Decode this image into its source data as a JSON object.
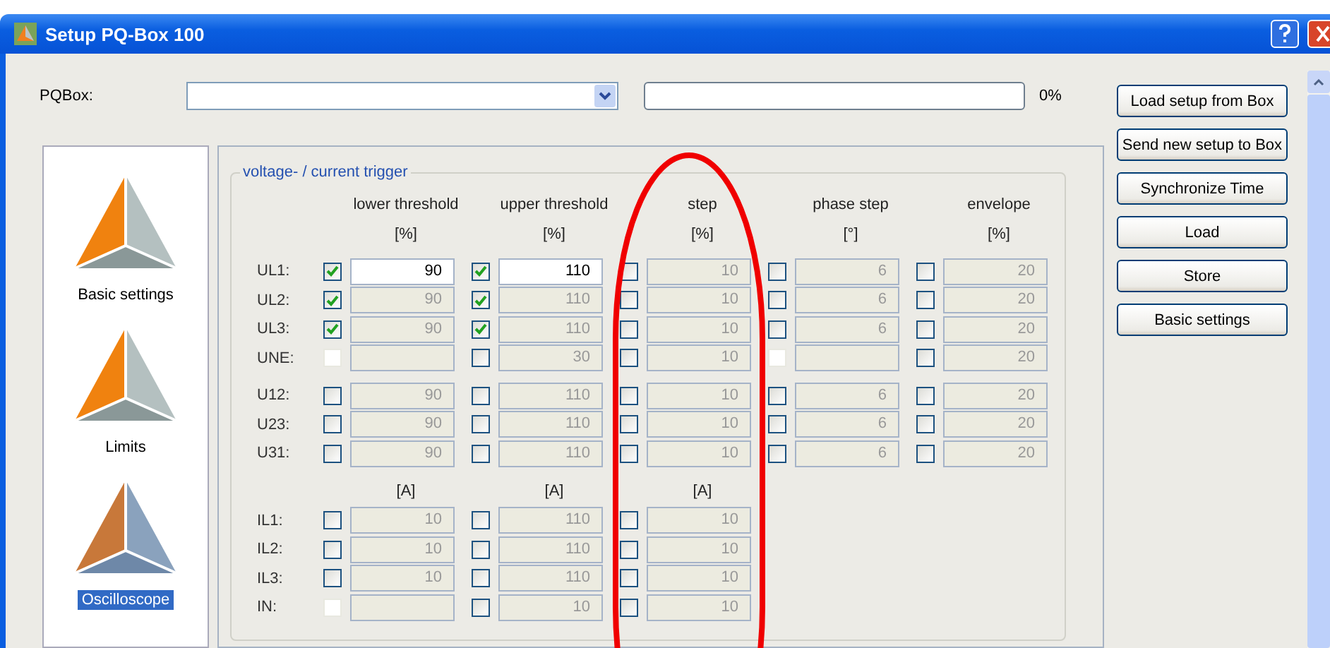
{
  "window": {
    "title": "Setup PQ-Box 100"
  },
  "device": {
    "label": "PQBox:",
    "progress_reading": "0%",
    "level": 0
  },
  "actions": [
    "Load setup from Box",
    "Send new setup to Box",
    "Synchronize Time",
    "Load",
    "Store",
    "Basic settings"
  ],
  "sidebar": {
    "items": [
      {
        "label": "Basic settings",
        "selected": false
      },
      {
        "label": "Limits",
        "selected": false
      },
      {
        "label": "Oscilloscope",
        "selected": true
      }
    ]
  },
  "trigger": {
    "title": "voltage- / current trigger",
    "columns": [
      {
        "label": "lower threshold",
        "unit": "[%]"
      },
      {
        "label": "upper threshold",
        "unit": "[%]"
      },
      {
        "label": "step",
        "unit": "[%]"
      },
      {
        "label": "phase step",
        "unit": "[°]"
      },
      {
        "label": "envelope",
        "unit": "[%]"
      }
    ],
    "groups": [
      {
        "rows": [
          {
            "label": "UL1:",
            "cells": [
              {
                "checked": true,
                "disabled": false,
                "active": true,
                "value": "90"
              },
              {
                "checked": true,
                "disabled": false,
                "active": true,
                "value": "110"
              },
              {
                "checked": false,
                "disabled": false,
                "active": false,
                "value": "10"
              },
              {
                "checked": false,
                "disabled": false,
                "active": false,
                "value": "6"
              },
              {
                "checked": false,
                "disabled": false,
                "active": false,
                "value": "20"
              }
            ]
          },
          {
            "label": "UL2:",
            "cells": [
              {
                "checked": true,
                "disabled": false,
                "active": false,
                "value": "90"
              },
              {
                "checked": true,
                "disabled": false,
                "active": false,
                "value": "110"
              },
              {
                "checked": false,
                "disabled": false,
                "active": false,
                "value": "10"
              },
              {
                "checked": false,
                "disabled": false,
                "active": false,
                "value": "6"
              },
              {
                "checked": false,
                "disabled": false,
                "active": false,
                "value": "20"
              }
            ]
          },
          {
            "label": "UL3:",
            "cells": [
              {
                "checked": true,
                "disabled": false,
                "active": false,
                "value": "90"
              },
              {
                "checked": true,
                "disabled": false,
                "active": false,
                "value": "110"
              },
              {
                "checked": false,
                "disabled": false,
                "active": false,
                "value": "10"
              },
              {
                "checked": false,
                "disabled": false,
                "active": false,
                "value": "6"
              },
              {
                "checked": false,
                "disabled": false,
                "active": false,
                "value": "20"
              }
            ]
          },
          {
            "label": "UNE:",
            "cells": [
              {
                "checked": false,
                "disabled": true,
                "active": false
              },
              {
                "checked": false,
                "disabled": false,
                "active": false,
                "value": "30"
              },
              {
                "checked": false,
                "disabled": false,
                "active": false,
                "value": "10"
              },
              {
                "checked": false,
                "disabled": true,
                "active": false
              },
              {
                "checked": false,
                "disabled": false,
                "active": false,
                "value": "20"
              }
            ]
          }
        ]
      },
      {
        "rows": [
          {
            "label": "U12:",
            "cells": [
              {
                "checked": false,
                "disabled": false,
                "active": false,
                "value": "90"
              },
              {
                "checked": false,
                "disabled": false,
                "active": false,
                "value": "110"
              },
              {
                "checked": false,
                "disabled": false,
                "active": false,
                "value": "10"
              },
              {
                "checked": false,
                "disabled": false,
                "active": false,
                "value": "6"
              },
              {
                "checked": false,
                "disabled": false,
                "active": false,
                "value": "20"
              }
            ]
          },
          {
            "label": "U23:",
            "cells": [
              {
                "checked": false,
                "disabled": false,
                "active": false,
                "value": "90"
              },
              {
                "checked": false,
                "disabled": false,
                "active": false,
                "value": "110"
              },
              {
                "checked": false,
                "disabled": false,
                "active": false,
                "value": "10"
              },
              {
                "checked": false,
                "disabled": false,
                "active": false,
                "value": "6"
              },
              {
                "checked": false,
                "disabled": false,
                "active": false,
                "value": "20"
              }
            ]
          },
          {
            "label": "U31:",
            "cells": [
              {
                "checked": false,
                "disabled": false,
                "active": false,
                "value": "90"
              },
              {
                "checked": false,
                "disabled": false,
                "active": false,
                "value": "110"
              },
              {
                "checked": false,
                "disabled": false,
                "active": false,
                "value": "10"
              },
              {
                "checked": false,
                "disabled": false,
                "active": false,
                "value": "6"
              },
              {
                "checked": false,
                "disabled": false,
                "active": false,
                "value": "20"
              }
            ]
          }
        ]
      },
      {
        "units": [
          "[A]",
          "[A]",
          "[A]"
        ],
        "rows": [
          {
            "label": "IL1:",
            "cells": [
              {
                "checked": false,
                "disabled": false,
                "active": false,
                "value": "10"
              },
              {
                "checked": false,
                "disabled": false,
                "active": false,
                "value": "110"
              },
              {
                "checked": false,
                "disabled": false,
                "active": false,
                "value": "10"
              }
            ]
          },
          {
            "label": "IL2:",
            "cells": [
              {
                "checked": false,
                "disabled": false,
                "active": false,
                "value": "10"
              },
              {
                "checked": false,
                "disabled": false,
                "active": false,
                "value": "110"
              },
              {
                "checked": false,
                "disabled": false,
                "active": false,
                "value": "10"
              }
            ]
          },
          {
            "label": "IL3:",
            "cells": [
              {
                "checked": false,
                "disabled": false,
                "active": false,
                "value": "10"
              },
              {
                "checked": false,
                "disabled": false,
                "active": false,
                "value": "110"
              },
              {
                "checked": false,
                "disabled": false,
                "active": false,
                "value": "10"
              }
            ]
          },
          {
            "label": "IN:",
            "cells": [
              {
                "checked": false,
                "disabled": true,
                "active": false
              },
              {
                "checked": false,
                "disabled": false,
                "active": false,
                "value": "10"
              },
              {
                "checked": false,
                "disabled": false,
                "active": false,
                "value": "10"
              }
            ]
          }
        ]
      }
    ]
  }
}
